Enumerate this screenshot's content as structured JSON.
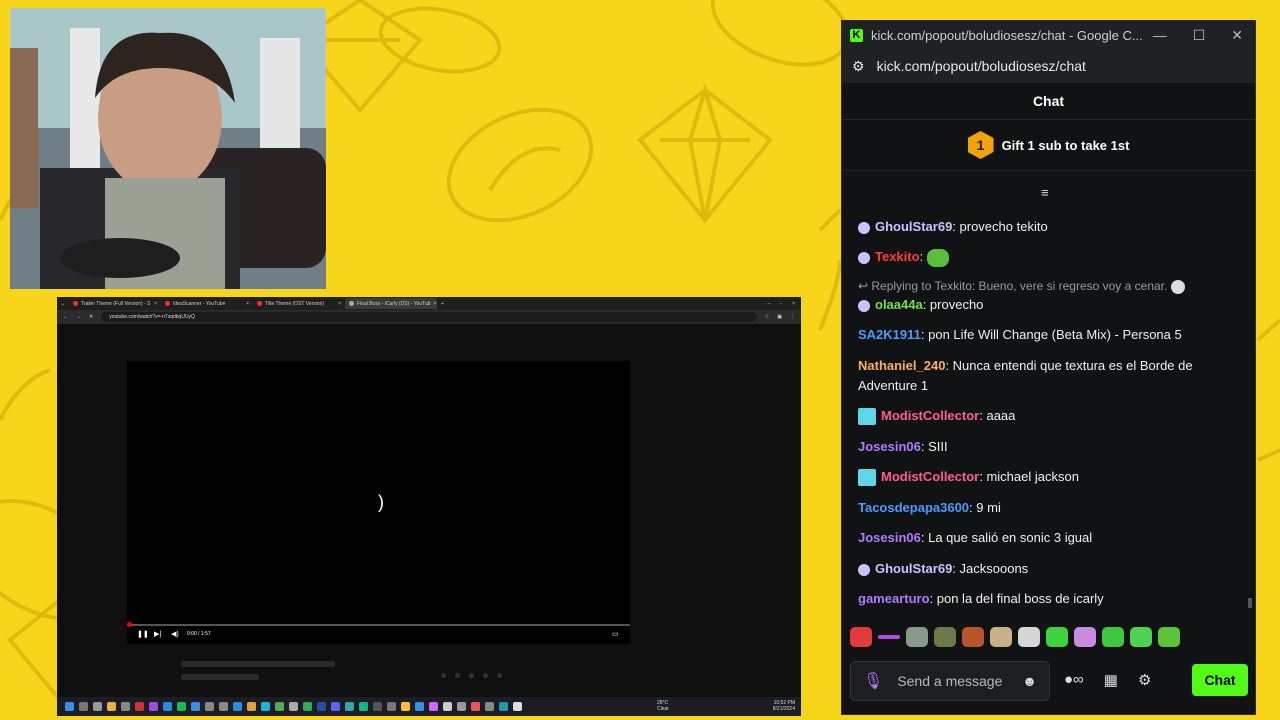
{
  "browser": {
    "tabs": [
      {
        "label": "Trailer Theme (Full Version) - S"
      },
      {
        "label": "IdeaScanner - YouTube"
      },
      {
        "label": "Title Theme (OST Version)"
      },
      {
        "label": "Final Boss - iCarly (DS) - YouTub"
      }
    ],
    "url": "youtube.com/watch?v=-n7sqdbqUUyQ",
    "video": {
      "time": "0:00 / 1:57",
      "progress": 0.0
    }
  },
  "taskbar": {
    "weather_temp": "28°C",
    "weather_desc": "Clear",
    "time": "10:52 PM",
    "date": "8/21/2024"
  },
  "chat_window": {
    "title": "kick.com/popout/boludiosesz/chat - Google C...",
    "url": "kick.com/popout/boludiosesz/chat",
    "header": "Chat",
    "gift_badge": "1",
    "gift_text": "Gift 1 sub to take 1st",
    "messages": [
      {
        "user": "GhoulStar69",
        "text": ": provecho tekito",
        "color": "#c9c4ff"
      },
      {
        "user": "Texkito",
        "text": ":",
        "color": "#ff3b3b"
      },
      {
        "reply": "Replying to Texkito: Bueno, vere si regreso voy a cenar."
      },
      {
        "user": "olaa44a",
        "text": ": provecho",
        "color": "#72e04a"
      },
      {
        "user": "SA2K1911",
        "text": ": pon Life Will Change (Beta Mix) - Persona 5",
        "color": "#4a9bff"
      },
      {
        "user": "Nathaniel_240",
        "text": ": Nunca entendi que textura es el Borde de Adventure 1",
        "color": "#f5b25b"
      },
      {
        "user": "ModistCollector",
        "text": ": aaaa",
        "color": "#ff5d8f"
      },
      {
        "user": "Josesin06",
        "text": ": SIII",
        "color": "#b07bff"
      },
      {
        "user": "ModistCollector",
        "text": ": michael jackson",
        "color": "#ff5d8f"
      },
      {
        "user": "Tacosdepapa3600",
        "text": ": 9 mi",
        "color": "#4a9bff"
      },
      {
        "user": "Josesin06",
        "text": ": La que salió en sonic 3 igual",
        "color": "#b07bff"
      },
      {
        "user": "GhoulStar69",
        "text": ": Jacksooons",
        "color": "#c9c4ff"
      },
      {
        "user": "gamearturo",
        "text": ": pon la del final boss de icarly",
        "color": "#b07bff"
      }
    ],
    "input_placeholder": "Send a message",
    "send_label": "Chat",
    "accent": "#53fc18"
  }
}
